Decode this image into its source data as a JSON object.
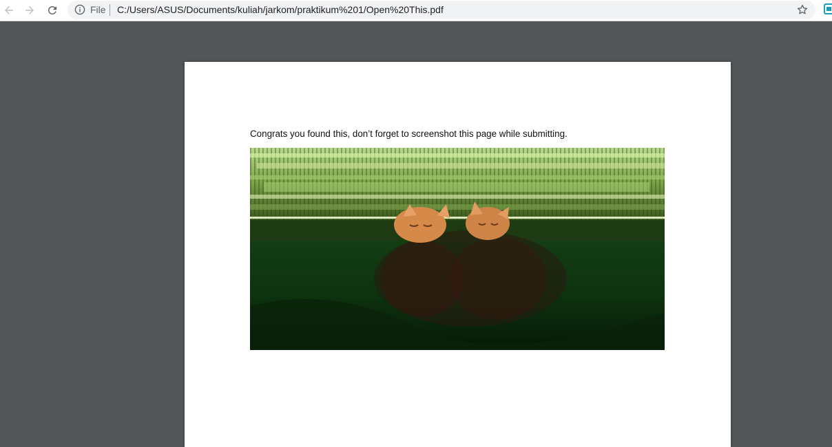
{
  "browser": {
    "scheme_label": "File",
    "url": "C:/Users/ASUS/Documents/kuliah/jarkom/praktikum%201/Open%20This.pdf",
    "icons": {
      "back": "arrow-left-icon",
      "forward": "arrow-right-icon",
      "reload": "reload-icon",
      "info": "info-icon",
      "bookmark": "star-icon",
      "extension": "extension-icon"
    }
  },
  "pdf": {
    "text": "Congrats you found this, don’t forget to screenshot this page while submitting.",
    "image_description": "glitched-photo-two-orange-cats"
  },
  "colors": {
    "viewer_bg": "#525659",
    "page_bg": "#ffffff",
    "omnibox_bg": "#f1f3f4"
  }
}
